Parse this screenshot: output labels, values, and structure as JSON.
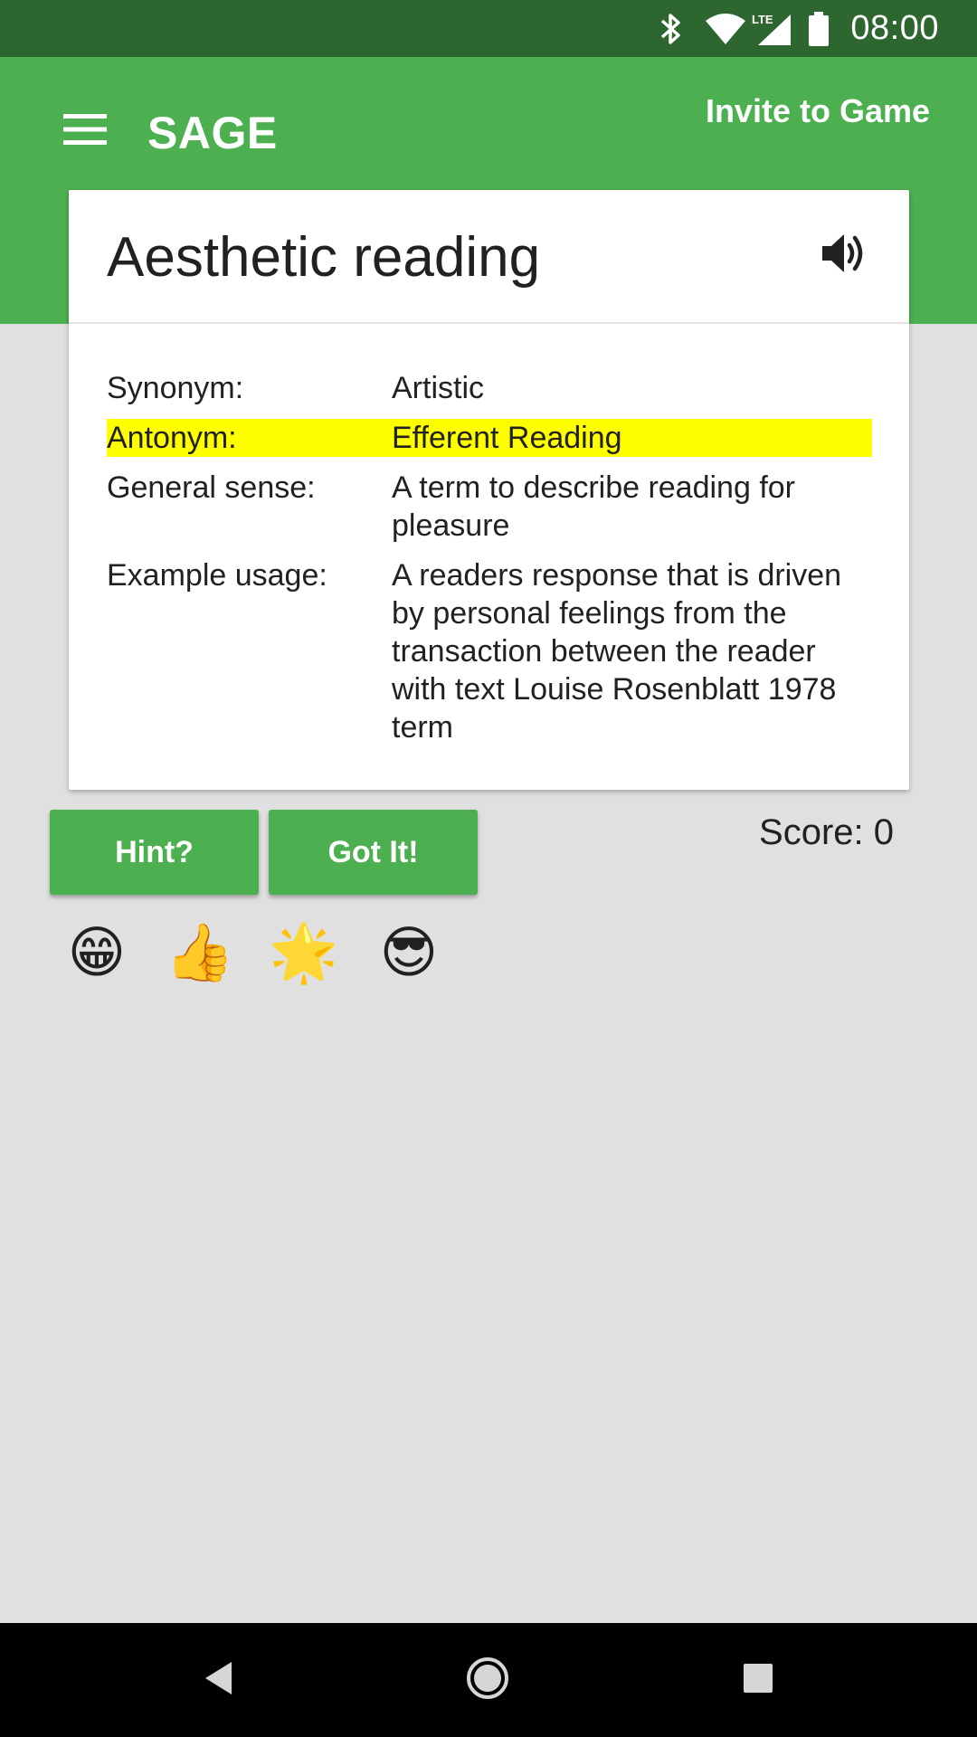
{
  "status_bar": {
    "time": "08:00",
    "network": "LTE",
    "icons": [
      "bluetooth-icon",
      "wifi-icon",
      "cellular-signal-icon",
      "battery-icon"
    ]
  },
  "app_bar": {
    "title": "SAGE",
    "menu_icon": "hamburger-menu-icon",
    "invite_label": "Invite to Game",
    "color": "#4caf50"
  },
  "card": {
    "term": "Aesthetic reading",
    "speaker_icon": "speaker-icon",
    "rows": [
      {
        "label": "Synonym:",
        "value": "Artistic",
        "highlight": false
      },
      {
        "label": "Antonym:",
        "value": "Efferent Reading",
        "highlight": true
      },
      {
        "label": "General sense:",
        "value": "A term to describe reading for pleasure",
        "highlight": false
      },
      {
        "label": "Example usage:",
        "value": "A readers response that is driven by personal feelings from the transaction between the reader with text Louise Rosenblatt 1978 term",
        "highlight": false
      }
    ],
    "highlight_color": "#ffff00"
  },
  "actions": {
    "hint_label": "Hint?",
    "got_it_label": "Got It!",
    "score_label": "Score: 0"
  },
  "reactions": [
    {
      "emoji": "😁",
      "name": "grinning-face-icon"
    },
    {
      "emoji": "👍",
      "name": "thumbs-up-icon"
    },
    {
      "emoji": "🌟",
      "name": "glowing-star-icon"
    },
    {
      "emoji": "😎",
      "name": "sunglasses-face-icon"
    }
  ],
  "nav_bar": {
    "icons": [
      "back-icon",
      "home-icon",
      "recents-icon"
    ]
  }
}
